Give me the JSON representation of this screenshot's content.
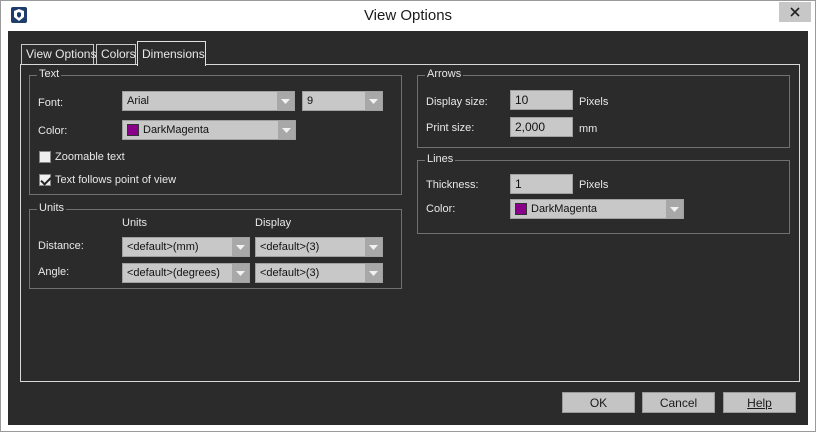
{
  "window": {
    "title": "View Options",
    "close_icon": "close-icon",
    "app_icon": "app-logo-icon"
  },
  "tabs": [
    {
      "label": "View Options",
      "active": false
    },
    {
      "label": "Colors",
      "active": false
    },
    {
      "label": "Dimensions",
      "active": true
    }
  ],
  "text_group": {
    "title": "Text",
    "font_label": "Font:",
    "font_value": "Arial",
    "font_size_value": "9",
    "color_label": "Color:",
    "color_value": "DarkMagenta",
    "color_swatch": "#8b008b",
    "zoomable_label": "Zoomable text",
    "zoomable_checked": false,
    "follows_label": "Text follows point of view",
    "follows_checked": true
  },
  "units_group": {
    "title": "Units",
    "col_units": "Units",
    "col_display": "Display",
    "distance_label": "Distance:",
    "distance_units": "<default>(mm)",
    "distance_display": "<default>(3)",
    "angle_label": "Angle:",
    "angle_units": "<default>(degrees)",
    "angle_display": "<default>(3)"
  },
  "arrows_group": {
    "title": "Arrows",
    "display_size_label": "Display size:",
    "display_size_value": "10",
    "display_size_unit": "Pixels",
    "print_size_label": "Print size:",
    "print_size_value": "2,000",
    "print_size_unit": "mm"
  },
  "lines_group": {
    "title": "Lines",
    "thickness_label": "Thickness:",
    "thickness_value": "1",
    "thickness_unit": "Pixels",
    "color_label": "Color:",
    "color_value": "DarkMagenta",
    "color_swatch": "#8b008b"
  },
  "buttons": {
    "ok": "OK",
    "cancel": "Cancel",
    "help": "Help"
  }
}
